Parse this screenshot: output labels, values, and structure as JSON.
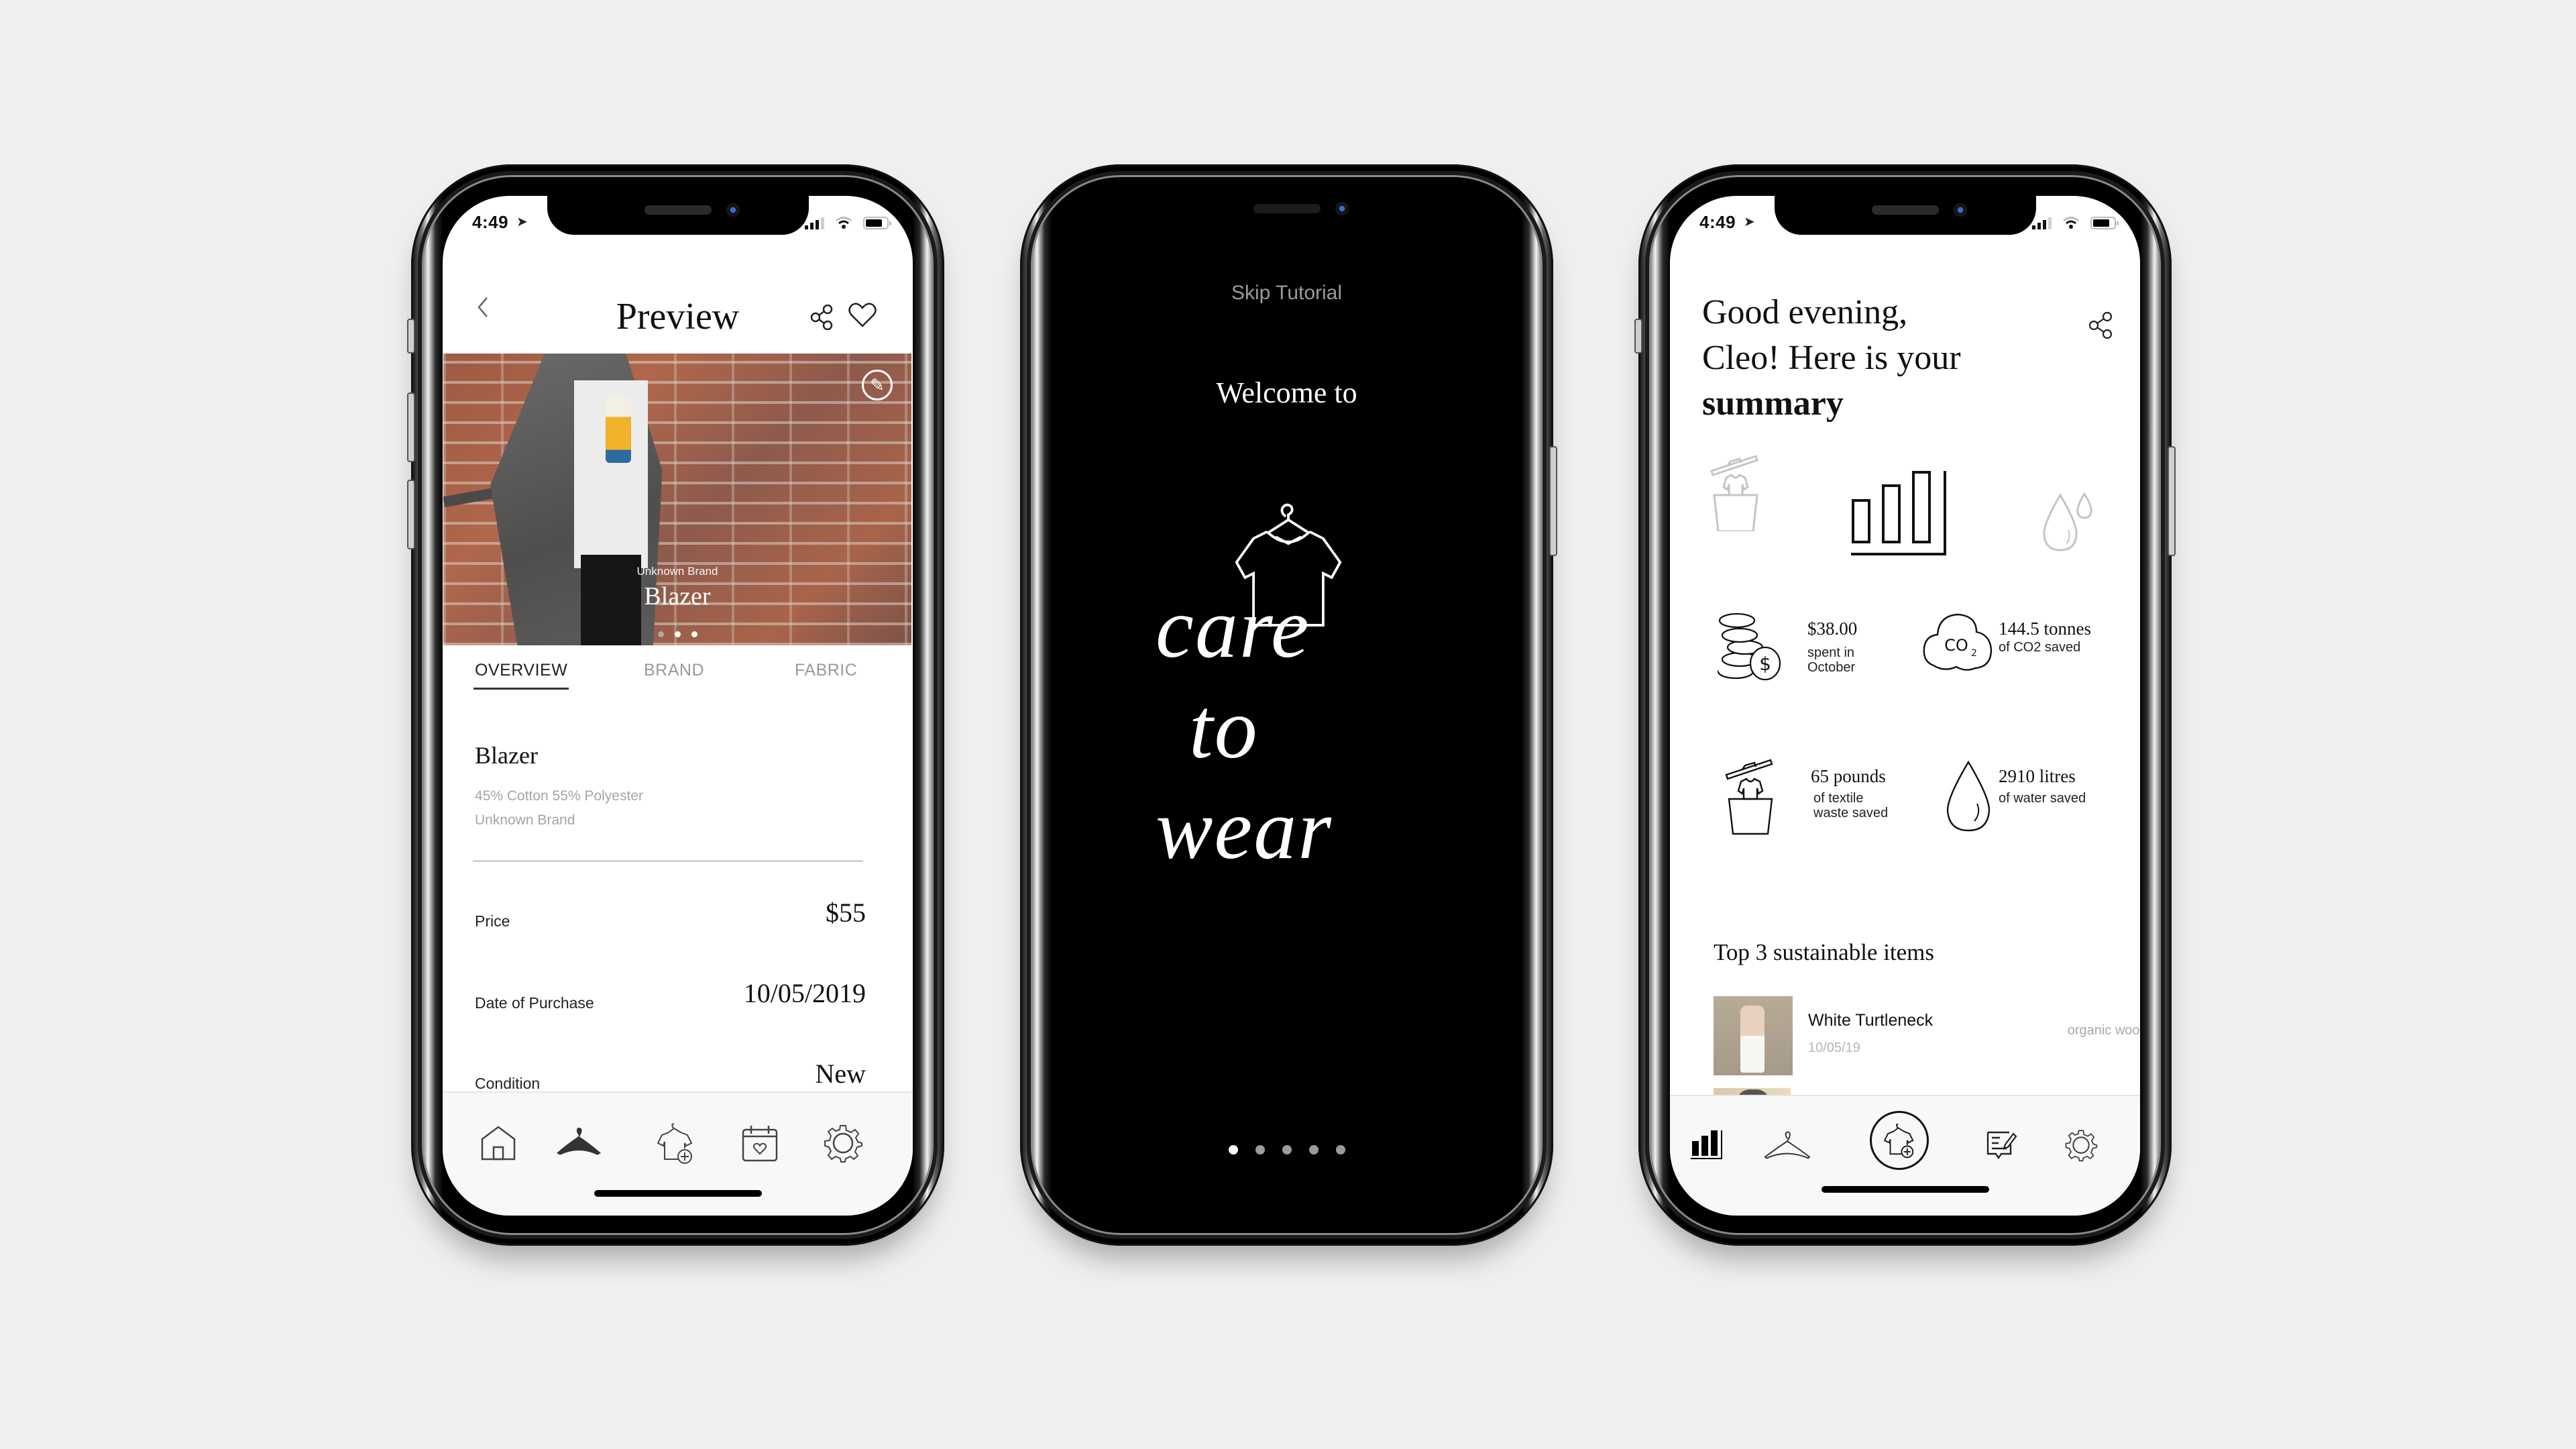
{
  "background_color": "#efefef",
  "phones": [
    {
      "id": "item-preview",
      "status": {
        "time": "4:49"
      },
      "header": {
        "title": "Preview",
        "back_icon": "chevron-left-icon",
        "share_icon": "share-icon",
        "favorite_icon": "heart-icon"
      },
      "hero": {
        "brand": "Unknown Brand",
        "name": "Blazer",
        "edit_icon": "pencil-icon",
        "carousel": {
          "count": 3,
          "active_index": 0
        }
      },
      "tabs": [
        {
          "label": "OVERVIEW",
          "active": true
        },
        {
          "label": "BRAND",
          "active": false
        },
        {
          "label": "FABRIC",
          "active": false
        }
      ],
      "overview": {
        "name": "Blazer",
        "composition": "45% Cotton 55% Polyester",
        "brand": "Unknown Brand",
        "rows": [
          {
            "label": "Price",
            "value": "$55"
          },
          {
            "label": "Date of Purchase",
            "value": "10/05/2019"
          },
          {
            "label": "Condition",
            "value": "New"
          }
        ]
      },
      "tabbar": [
        {
          "icon": "home-icon",
          "active": false
        },
        {
          "icon": "hanger-icon",
          "active": true
        },
        {
          "icon": "add-clothing-icon",
          "active": false
        },
        {
          "icon": "calendar-heart-icon",
          "active": false
        },
        {
          "icon": "gear-icon",
          "active": false
        }
      ]
    },
    {
      "id": "onboarding",
      "skip_label": "Skip Tutorial",
      "welcome": "Welcome to",
      "app_name_lines": [
        "care",
        "to",
        "wear"
      ],
      "pager": {
        "count": 5,
        "active_index": 0
      }
    },
    {
      "id": "summary",
      "status": {
        "time": "4:49"
      },
      "greeting": {
        "line1": "Good evening,",
        "line2": "Cleo! Here is your",
        "line3": "summary"
      },
      "share_icon": "share-icon",
      "category_icons": [
        {
          "icon": "textile-bin-icon",
          "active": false
        },
        {
          "icon": "bar-chart-icon",
          "active": true
        },
        {
          "icon": "water-drops-icon",
          "active": false
        }
      ],
      "stats": [
        {
          "icon": "coins-icon",
          "value": "$38.00",
          "caption_lines": [
            "spent in",
            "October"
          ]
        },
        {
          "icon": "co2-cloud-icon",
          "value": "144.5 tonnes",
          "caption_lines": [
            "of CO2 saved"
          ]
        },
        {
          "icon": "textile-bin-icon",
          "value": "65 pounds",
          "caption_lines": [
            "of textile",
            "waste saved"
          ]
        },
        {
          "icon": "water-drop-icon",
          "value": "2910 litres",
          "caption_lines": [
            "of water saved"
          ]
        }
      ],
      "top_items_title": "Top 3 sustainable items",
      "top_items": [
        {
          "title": "White Turtleneck",
          "date": "10/05/19",
          "material": "organic wool"
        }
      ],
      "tabbar": [
        {
          "icon": "bar-chart-icon",
          "active": true
        },
        {
          "icon": "hanger-icon",
          "active": false
        },
        {
          "icon": "add-clothing-icon",
          "active": false,
          "highlighted": true
        },
        {
          "icon": "notes-edit-icon",
          "active": false
        },
        {
          "icon": "gear-icon",
          "active": false
        }
      ]
    }
  ]
}
